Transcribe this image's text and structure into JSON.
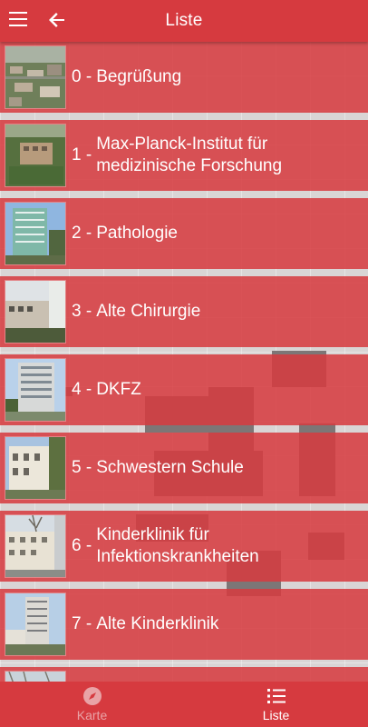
{
  "appbar": {
    "title": "Liste"
  },
  "items": [
    {
      "number": "0 -",
      "label": "Begrüßung"
    },
    {
      "number": "1 -",
      "label": "Max-Planck-Institut für medizinische Forschung"
    },
    {
      "number": "2 -",
      "label": "Pathologie"
    },
    {
      "number": "3 -",
      "label": "Alte Chirurgie"
    },
    {
      "number": "4 -",
      "label": "DKFZ"
    },
    {
      "number": "5 -",
      "label": "Schwestern Schule"
    },
    {
      "number": "6 -",
      "label": "Kinderklinik für Infektionskrankheiten"
    },
    {
      "number": "7 -",
      "label": "Alte Kinderklinik"
    }
  ],
  "bottom_nav": {
    "map_tab": {
      "label": "Karte",
      "icon": "compass-icon",
      "active": false
    },
    "list_tab": {
      "label": "Liste",
      "icon": "list-icon",
      "active": true
    }
  },
  "colors": {
    "primary": "#d63a3f",
    "inactive_tab": "#e9a3a6"
  }
}
